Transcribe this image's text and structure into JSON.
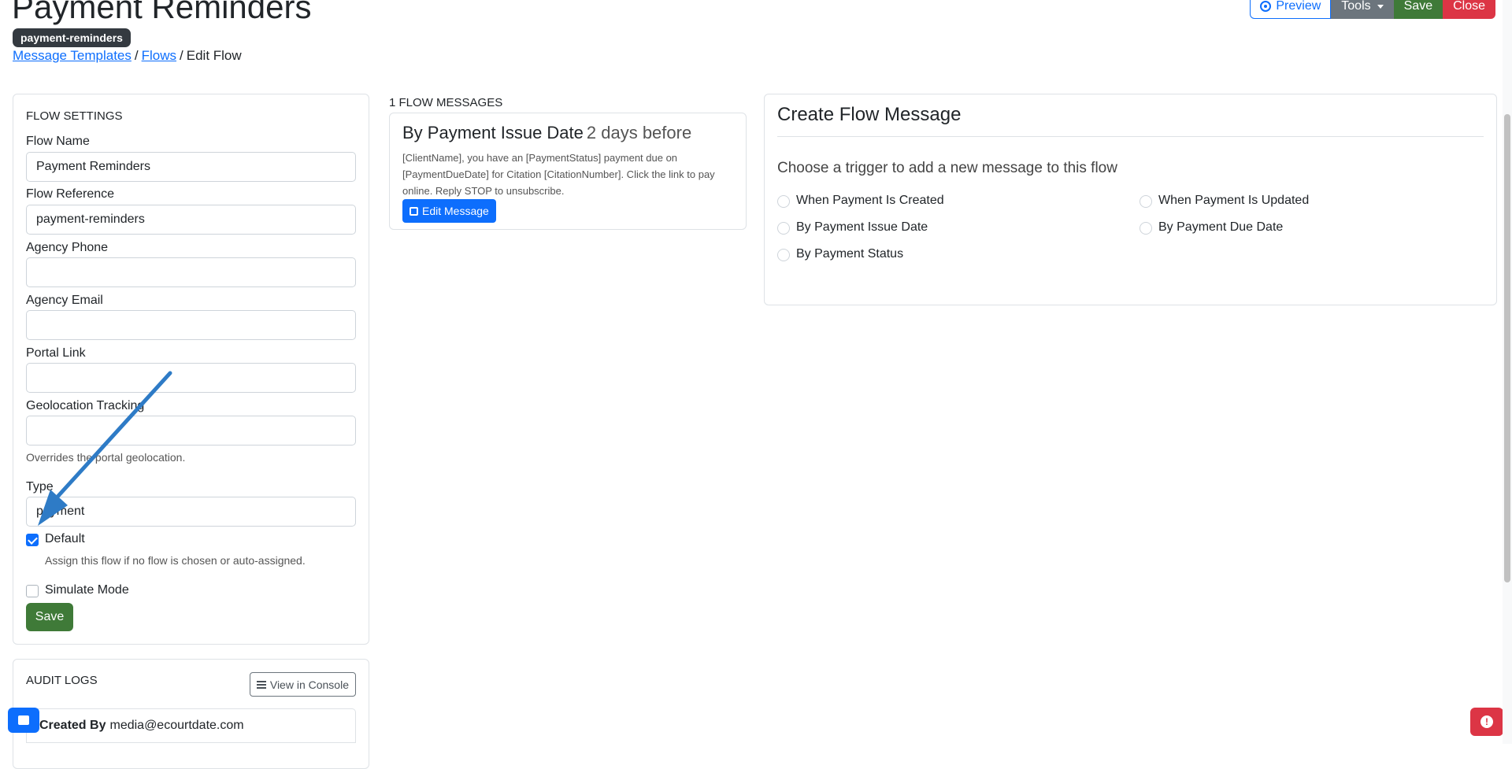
{
  "header": {
    "title": "Payment Reminders",
    "badge": "payment-reminders",
    "breadcrumb": [
      {
        "label": "Message Templates"
      },
      {
        "label": "Flows"
      },
      {
        "label": "Edit Flow"
      }
    ],
    "actions": {
      "preview": "Preview",
      "tools": "Tools",
      "save": "Save",
      "close": "Close"
    }
  },
  "flow_settings": {
    "heading": "FLOW SETTINGS",
    "fields": {
      "flow_name": {
        "label": "Flow Name",
        "value": "Payment Reminders"
      },
      "flow_reference": {
        "label": "Flow Reference",
        "value": "payment-reminders"
      },
      "agency_phone": {
        "label": "Agency Phone",
        "value": ""
      },
      "agency_email": {
        "label": "Agency Email",
        "value": ""
      },
      "portal_link": {
        "label": "Portal Link",
        "value": ""
      },
      "geolocation": {
        "label": "Geolocation Tracking",
        "value": "",
        "help": "Overrides the portal geolocation."
      },
      "type": {
        "label": "Type",
        "value": "payment"
      }
    },
    "default": {
      "label": "Default",
      "help": "Assign this flow if no flow is chosen or auto-assigned.",
      "checked": true
    },
    "simulate": {
      "label": "Simulate Mode",
      "checked": false
    },
    "save": "Save"
  },
  "audit_logs": {
    "heading": "AUDIT LOGS",
    "console_button": "View in Console",
    "created_by_label": "Created By",
    "created_by_value": "media@ecourtdate.com"
  },
  "flow_messages": {
    "count_label": "1 FLOW MESSAGES",
    "items": [
      {
        "title": "By Payment Issue Date",
        "timing": "2 days before",
        "body": "[ClientName], you have an [PaymentStatus] payment due on [PaymentDueDate] for Citation [CitationNumber]. Click the link to pay online. Reply STOP to unsubscribe.",
        "edit_label": "Edit Message"
      }
    ]
  },
  "create_flow": {
    "title": "Create Flow Message",
    "subtitle": "Choose a trigger to add a new message to this flow",
    "triggers": [
      "When Payment Is Created",
      "When Payment Is Updated",
      "By Payment Issue Date",
      "By Payment Due Date",
      "By Payment Status"
    ]
  },
  "colors": {
    "primary": "#0d6efd",
    "success": "#3f7a38",
    "danger": "#dc3545",
    "secondary": "#6c757d",
    "annotation_arrow": "#2e7bc6"
  }
}
